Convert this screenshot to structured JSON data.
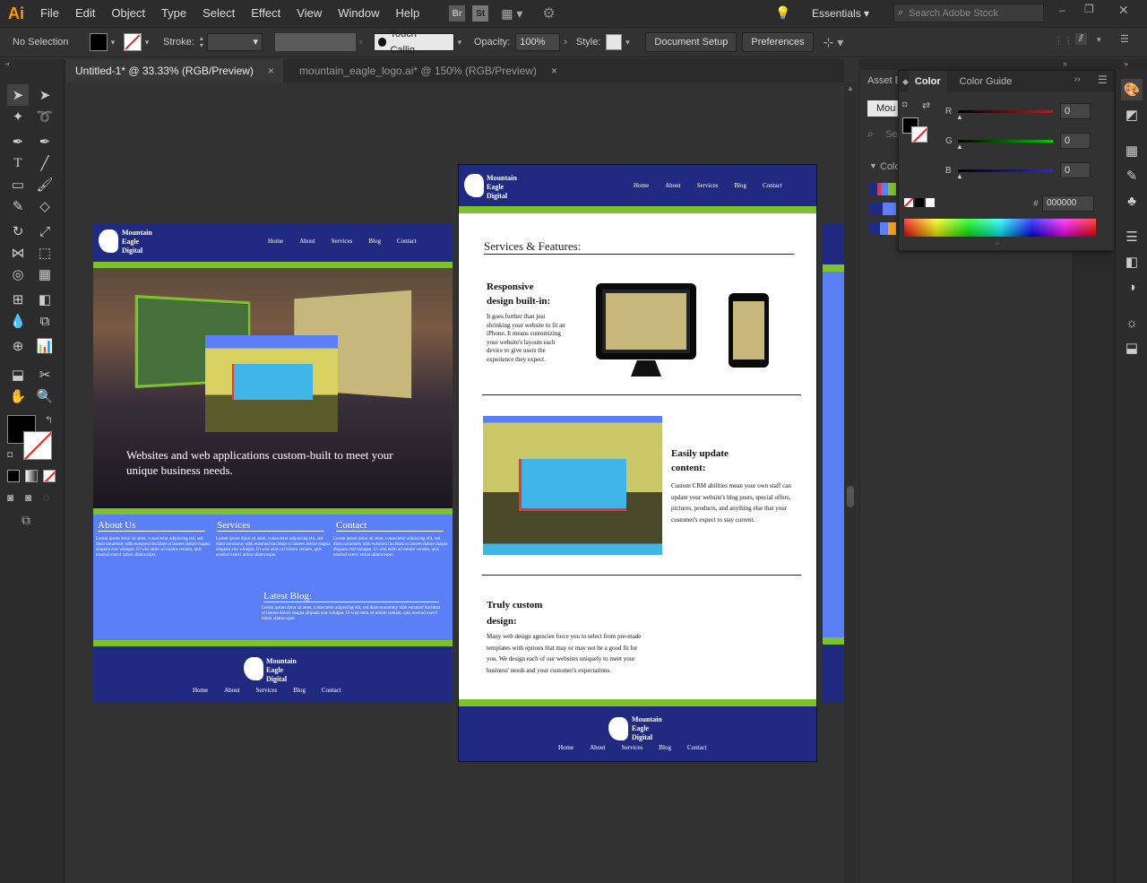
{
  "app": {
    "logo": "Ai"
  },
  "menu": [
    "File",
    "Edit",
    "Object",
    "Type",
    "Select",
    "Effect",
    "View",
    "Window",
    "Help"
  ],
  "menu_badges": [
    "Br",
    "St"
  ],
  "workspace": "Essentials",
  "search_placeholder": "Search Adobe Stock",
  "control": {
    "selection": "No Selection",
    "stroke_label": "Stroke:",
    "brush": "Touch Callig...",
    "opacity_label": "Opacity:",
    "opacity": "100%",
    "style_label": "Style:",
    "doc_setup": "Document Setup",
    "preferences": "Preferences"
  },
  "tabs": [
    {
      "label": "Untitled-1* @ 33.33% (RGB/Preview)",
      "close": "×"
    },
    {
      "label": "mountain_eagle_logo.ai* @ 150% (RGB/Preview)",
      "close": "×"
    }
  ],
  "color_panel": {
    "tabs": [
      "Color",
      "Color Guide"
    ],
    "r_label": "R",
    "g_label": "G",
    "b_label": "B",
    "r": "0",
    "g": "0",
    "b": "0",
    "hash": "#",
    "hex": "000000"
  },
  "asset_panel": {
    "tab": "Asset E",
    "field": "Mou",
    "search": "Se",
    "colors_label": "Colo"
  },
  "site": {
    "brand_line1": "Mountain",
    "brand_line2": "Eagle",
    "brand_line3": "Digital",
    "nav": [
      "Home",
      "About",
      "Services",
      "Blog",
      "Contact"
    ],
    "hero_text": "Websites and web applications custom-built to meet your unique business needs.",
    "sections": [
      "About Us",
      "Services",
      "Contact"
    ],
    "lorem": "Lorem ipsum dolor sit amet, consectetur adipiscing elit, sed diam nonummy nibh euismod tincidunt ut laoreet dolore magna aliquam erat volutpat. Ut wisi enim ad minim veniam, quis nostrud exerci tation ullamcorper.",
    "read_more": "Read more.",
    "latest_blog": "Latest Blog:",
    "services_title": "Services & Features:",
    "feature1_title": "Responsive design built-in:",
    "feature1_text": "It goes further than just shrinking your website to fit an iPhone. It means customizing your website's layouts each device to give users the experience they expect.",
    "feature2_title": "Easily update content:",
    "feature2_text": "Custom CRM abilities mean your own staff can update your website's blog posts, special offers, pictures, products, and anything else that your customer's expect to stay current.",
    "feature3_title": "Truly custom design:",
    "feature3_text": "Many web design agencies force you to select from pre-made templates with options that may or may not be a good fit for you. We design each of our websites uniquely to meet your business' needs and your customer's expectations."
  },
  "colors": {
    "navy": "#1f2a80",
    "green": "#7dc12d",
    "blue": "#5b7ff7",
    "accent": "#ff9a00"
  }
}
